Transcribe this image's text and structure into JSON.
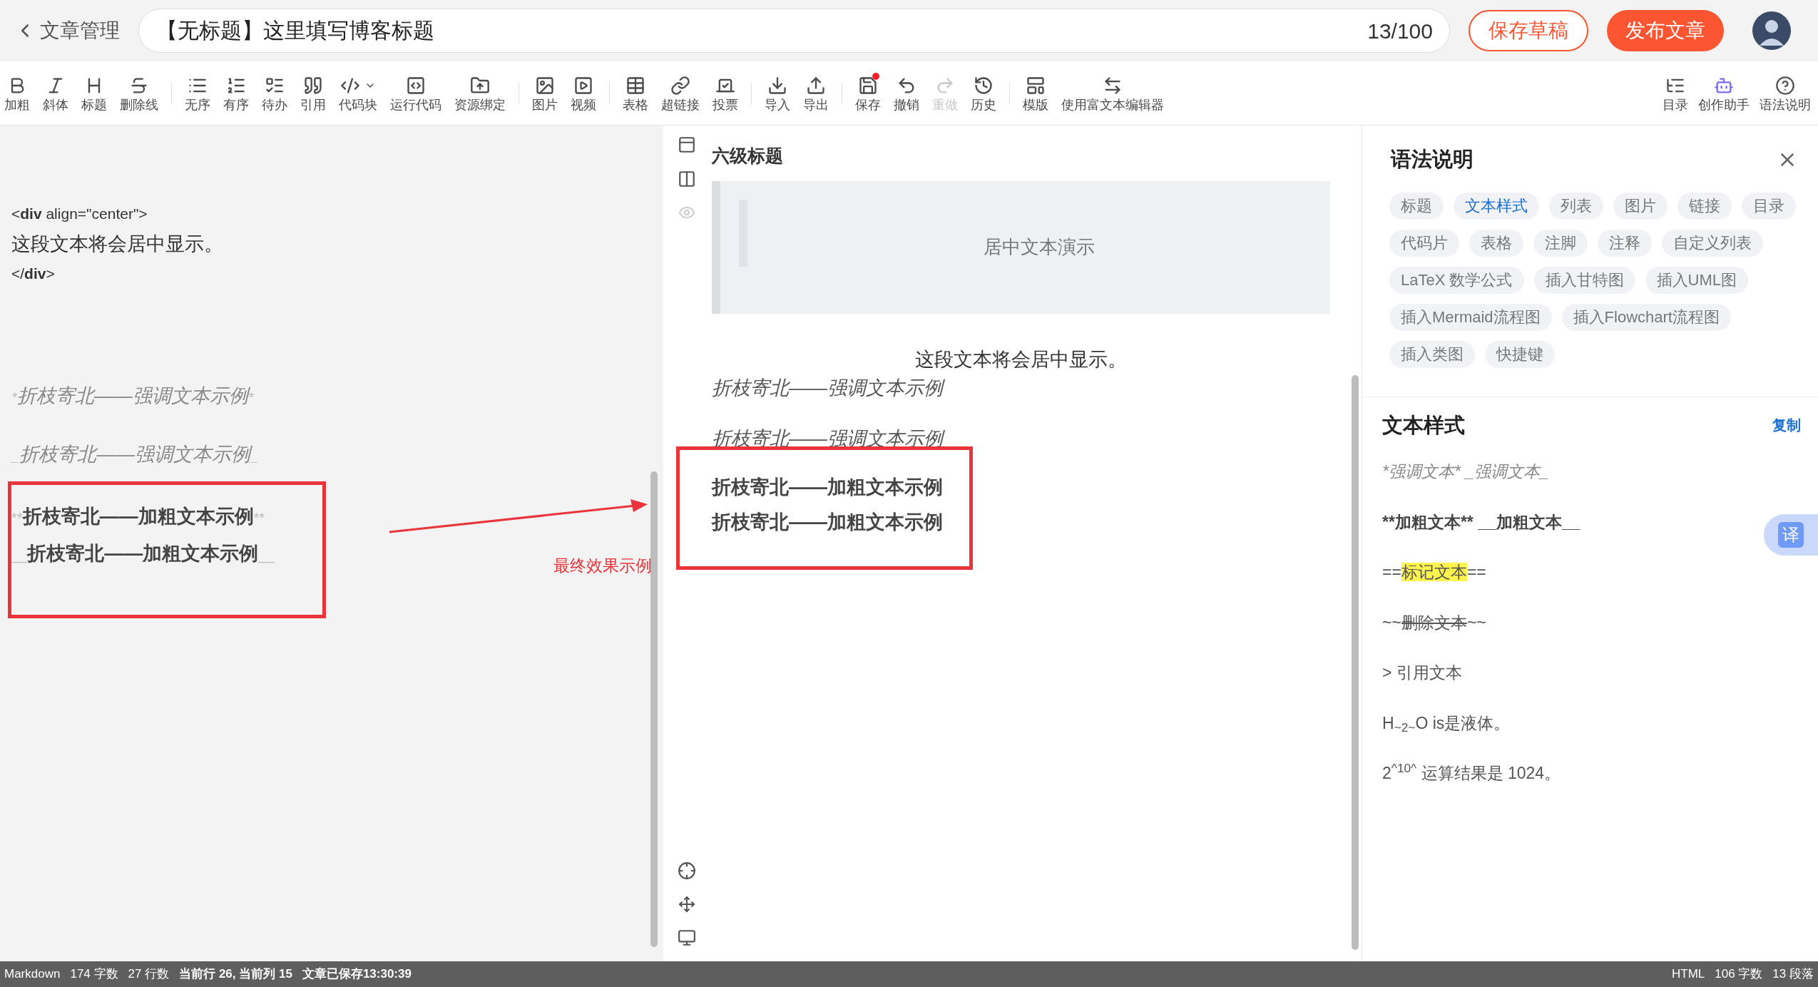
{
  "header": {
    "back_label": "文章管理",
    "title_value": "【无标题】这里填写博客标题",
    "counter": "13/100",
    "save_draft": "保存草稿",
    "publish": "发布文章"
  },
  "toolbar": {
    "groups": [
      [
        {
          "label": "加粗",
          "disabled": false,
          "dot": false
        },
        {
          "label": "斜体",
          "disabled": false,
          "dot": false
        },
        {
          "label": "标题",
          "disabled": false,
          "dot": false
        },
        {
          "label": "删除线",
          "disabled": false,
          "dot": false
        }
      ],
      [
        {
          "label": "无序",
          "disabled": false,
          "dot": false
        },
        {
          "label": "有序",
          "disabled": false,
          "dot": false
        },
        {
          "label": "待办",
          "disabled": false,
          "dot": false
        },
        {
          "label": "引用",
          "disabled": false,
          "dot": false
        },
        {
          "label": "代码块",
          "disabled": false,
          "dot": false
        },
        {
          "label": "运行代码",
          "disabled": false,
          "dot": false
        },
        {
          "label": "资源绑定",
          "disabled": false,
          "dot": false
        }
      ],
      [
        {
          "label": "图片",
          "disabled": false,
          "dot": false
        },
        {
          "label": "视频",
          "disabled": false,
          "dot": false
        }
      ],
      [
        {
          "label": "表格",
          "disabled": false,
          "dot": false
        },
        {
          "label": "超链接",
          "disabled": false,
          "dot": false
        },
        {
          "label": "投票",
          "disabled": false,
          "dot": false
        }
      ],
      [
        {
          "label": "导入",
          "disabled": false,
          "dot": false
        },
        {
          "label": "导出",
          "disabled": false,
          "dot": false
        }
      ],
      [
        {
          "label": "保存",
          "disabled": false,
          "dot": true
        },
        {
          "label": "撤销",
          "disabled": false,
          "dot": false
        },
        {
          "label": "重做",
          "disabled": true,
          "dot": false
        },
        {
          "label": "历史",
          "disabled": false,
          "dot": false
        }
      ],
      [
        {
          "label": "模版",
          "disabled": false,
          "dot": false
        },
        {
          "label": "使用富文本编辑器",
          "disabled": false,
          "dot": false
        }
      ]
    ],
    "right": [
      {
        "label": "目录"
      },
      {
        "label": "创作助手"
      },
      {
        "label": "语法说明"
      }
    ]
  },
  "editor": {
    "lines": [
      {
        "kind": "tag",
        "prefix": "<",
        "tag": "div",
        "rest": " align=\"center\">"
      },
      {
        "kind": "text",
        "text": "这段文本将会居中显示。"
      },
      {
        "kind": "tag",
        "prefix": "</",
        "tag": "div",
        "rest": ">"
      },
      {
        "kind": "italic",
        "mark": "*",
        "text": "折枝寄北——强调文本示例"
      },
      {
        "kind": "italic",
        "mark": "_",
        "text": "折枝寄北——强调文本示例"
      },
      {
        "kind": "bold",
        "mark": "**",
        "text": "折枝寄北——加粗文本示例"
      },
      {
        "kind": "bold",
        "mark": "__",
        "text": "折枝寄北——加粗文本示例"
      }
    ]
  },
  "annotation": {
    "label": "最终效果示例"
  },
  "preview": {
    "heading": "六级标题",
    "quote": "居中文本演示",
    "centered": "这段文本将会居中显示。",
    "italic": [
      "折枝寄北——强调文本示例",
      "折枝寄北——强调文本示例"
    ],
    "bold": [
      "折枝寄北——加粗文本示例",
      "折枝寄北——加粗文本示例"
    ]
  },
  "syntax_panel": {
    "title": "语法说明",
    "tags": [
      {
        "label": "标题",
        "selected": false
      },
      {
        "label": "文本样式",
        "selected": true
      },
      {
        "label": "列表",
        "selected": false
      },
      {
        "label": "图片",
        "selected": false
      },
      {
        "label": "链接",
        "selected": false
      },
      {
        "label": "目录",
        "selected": false
      },
      {
        "label": "代码片",
        "selected": false
      },
      {
        "label": "表格",
        "selected": false
      },
      {
        "label": "注脚",
        "selected": false
      },
      {
        "label": "注释",
        "selected": false
      },
      {
        "label": "自定义列表",
        "selected": false
      },
      {
        "label": "LaTeX 数学公式",
        "selected": false
      },
      {
        "label": "插入甘特图",
        "selected": false
      },
      {
        "label": "插入UML图",
        "selected": false
      },
      {
        "label": "插入Mermaid流程图",
        "selected": false
      },
      {
        "label": "插入Flowchart流程图",
        "selected": false
      },
      {
        "label": "插入类图",
        "selected": false
      },
      {
        "label": "快捷键",
        "selected": false
      }
    ],
    "section_title": "文本样式",
    "copy": "复制",
    "examples": [
      {
        "kind": "italic",
        "text": "*强调文本* _强调文本_"
      },
      {
        "kind": "bold",
        "text": "**加粗文本** __加粗文本__"
      },
      {
        "kind": "mark",
        "prefix": "==",
        "inner": "标记文本",
        "suffix": "=="
      },
      {
        "kind": "strike",
        "prefix": "~~",
        "inner": "删除文本",
        "suffix": "~~"
      },
      {
        "kind": "plain",
        "text": "> 引用文本"
      },
      {
        "kind": "rich",
        "text": "H$_{~2~}$O is是液体。"
      },
      {
        "kind": "rich",
        "text": "2$^{^10^}$ 运算结果是 1024。"
      }
    ]
  },
  "translate_button": "译",
  "status_bar": {
    "left": [
      "Markdown",
      "174 字数",
      "27 行数"
    ],
    "position": "当前行 26, 当前列 15",
    "saved": "文章已保存13:30:39",
    "right": [
      "HTML",
      "106 字数",
      "13 段落"
    ]
  }
}
